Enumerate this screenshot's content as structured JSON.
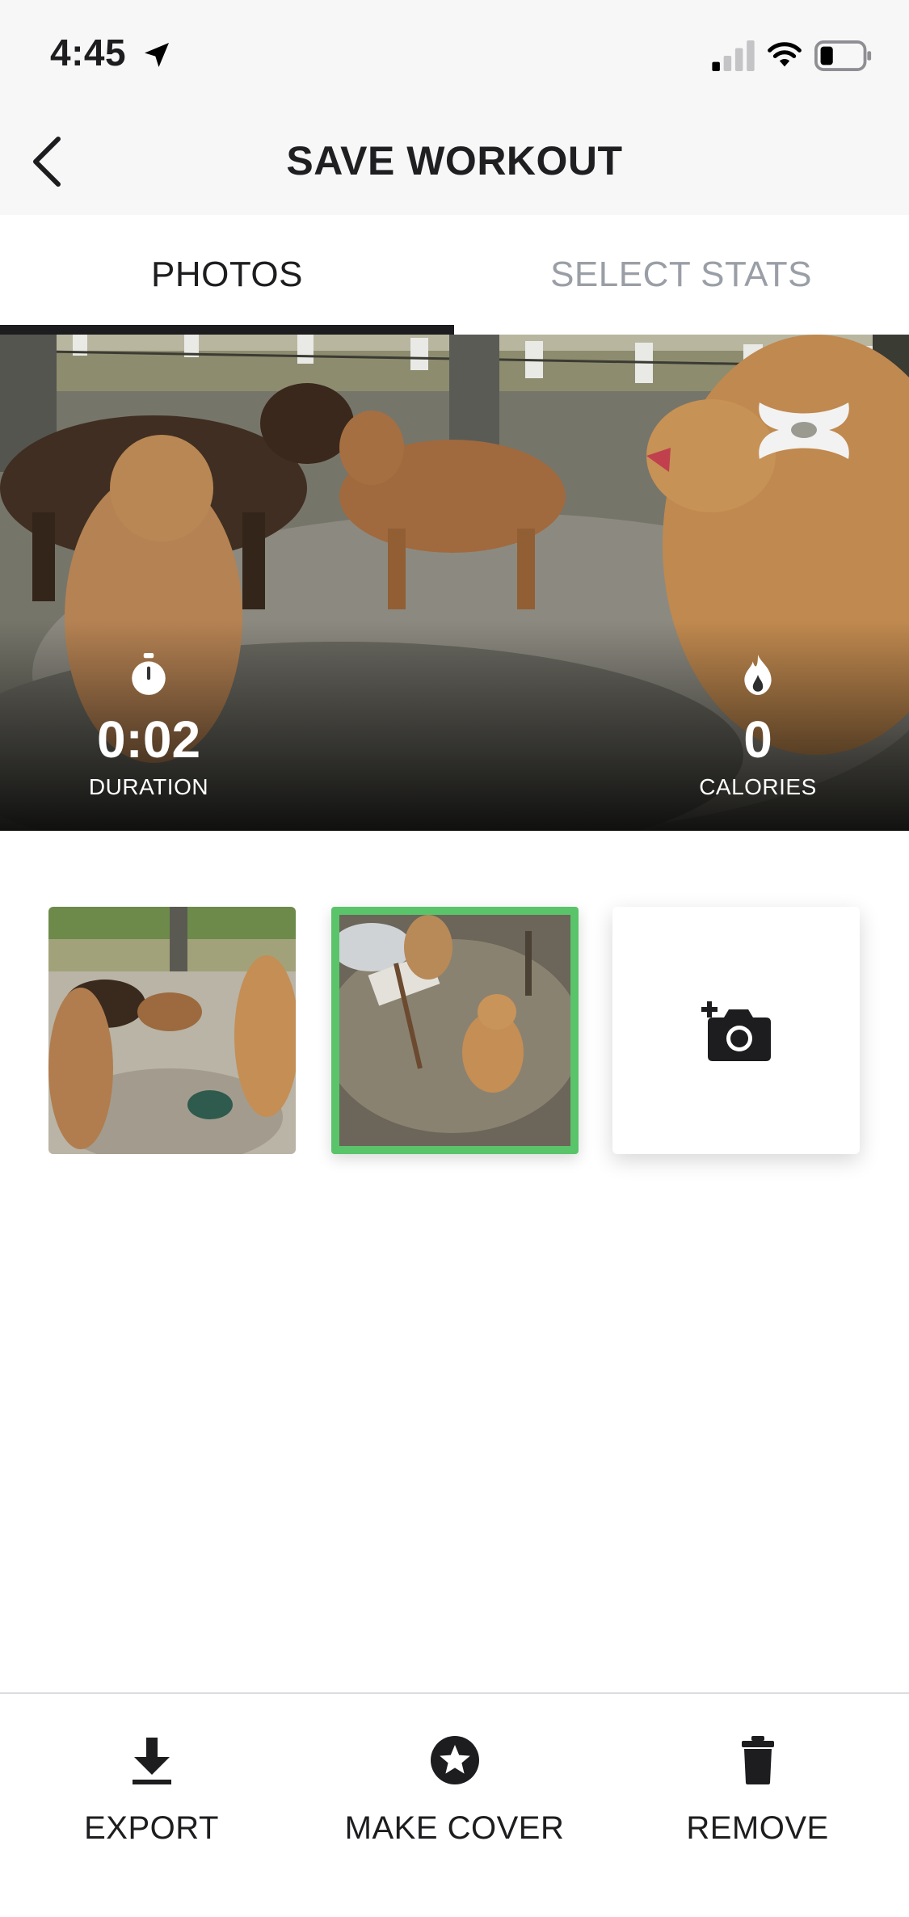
{
  "status_bar": {
    "time": "4:45",
    "icons": [
      "location-arrow-icon",
      "cellular-signal-icon",
      "wifi-icon",
      "battery-icon"
    ]
  },
  "header": {
    "title": "SAVE WORKOUT",
    "back_icon": "chevron-left-icon"
  },
  "tabs": [
    {
      "label": "PHOTOS",
      "active": true
    },
    {
      "label": "SELECT STATS",
      "active": false
    }
  ],
  "hero": {
    "logo": "brand-logo",
    "stats": [
      {
        "icon": "stopwatch-icon",
        "value": "0:02",
        "label": "DURATION"
      },
      {
        "icon": "flame-icon",
        "value": "0",
        "label": "CALORIES"
      }
    ]
  },
  "thumbnails": [
    {
      "type": "photo",
      "selected": false
    },
    {
      "type": "photo",
      "selected": true
    },
    {
      "type": "add",
      "icon": "add-photo-camera-icon"
    }
  ],
  "toolbar": [
    {
      "icon": "download-icon",
      "label": "EXPORT"
    },
    {
      "icon": "star-circle-icon",
      "label": "MAKE COVER"
    },
    {
      "icon": "trash-icon",
      "label": "REMOVE"
    }
  ],
  "colors": {
    "accent_selected": "#5ac46a",
    "tab_active": "#1d1d1f",
    "tab_inactive": "#9a9ea6",
    "header_bg": "#f7f7f8"
  }
}
